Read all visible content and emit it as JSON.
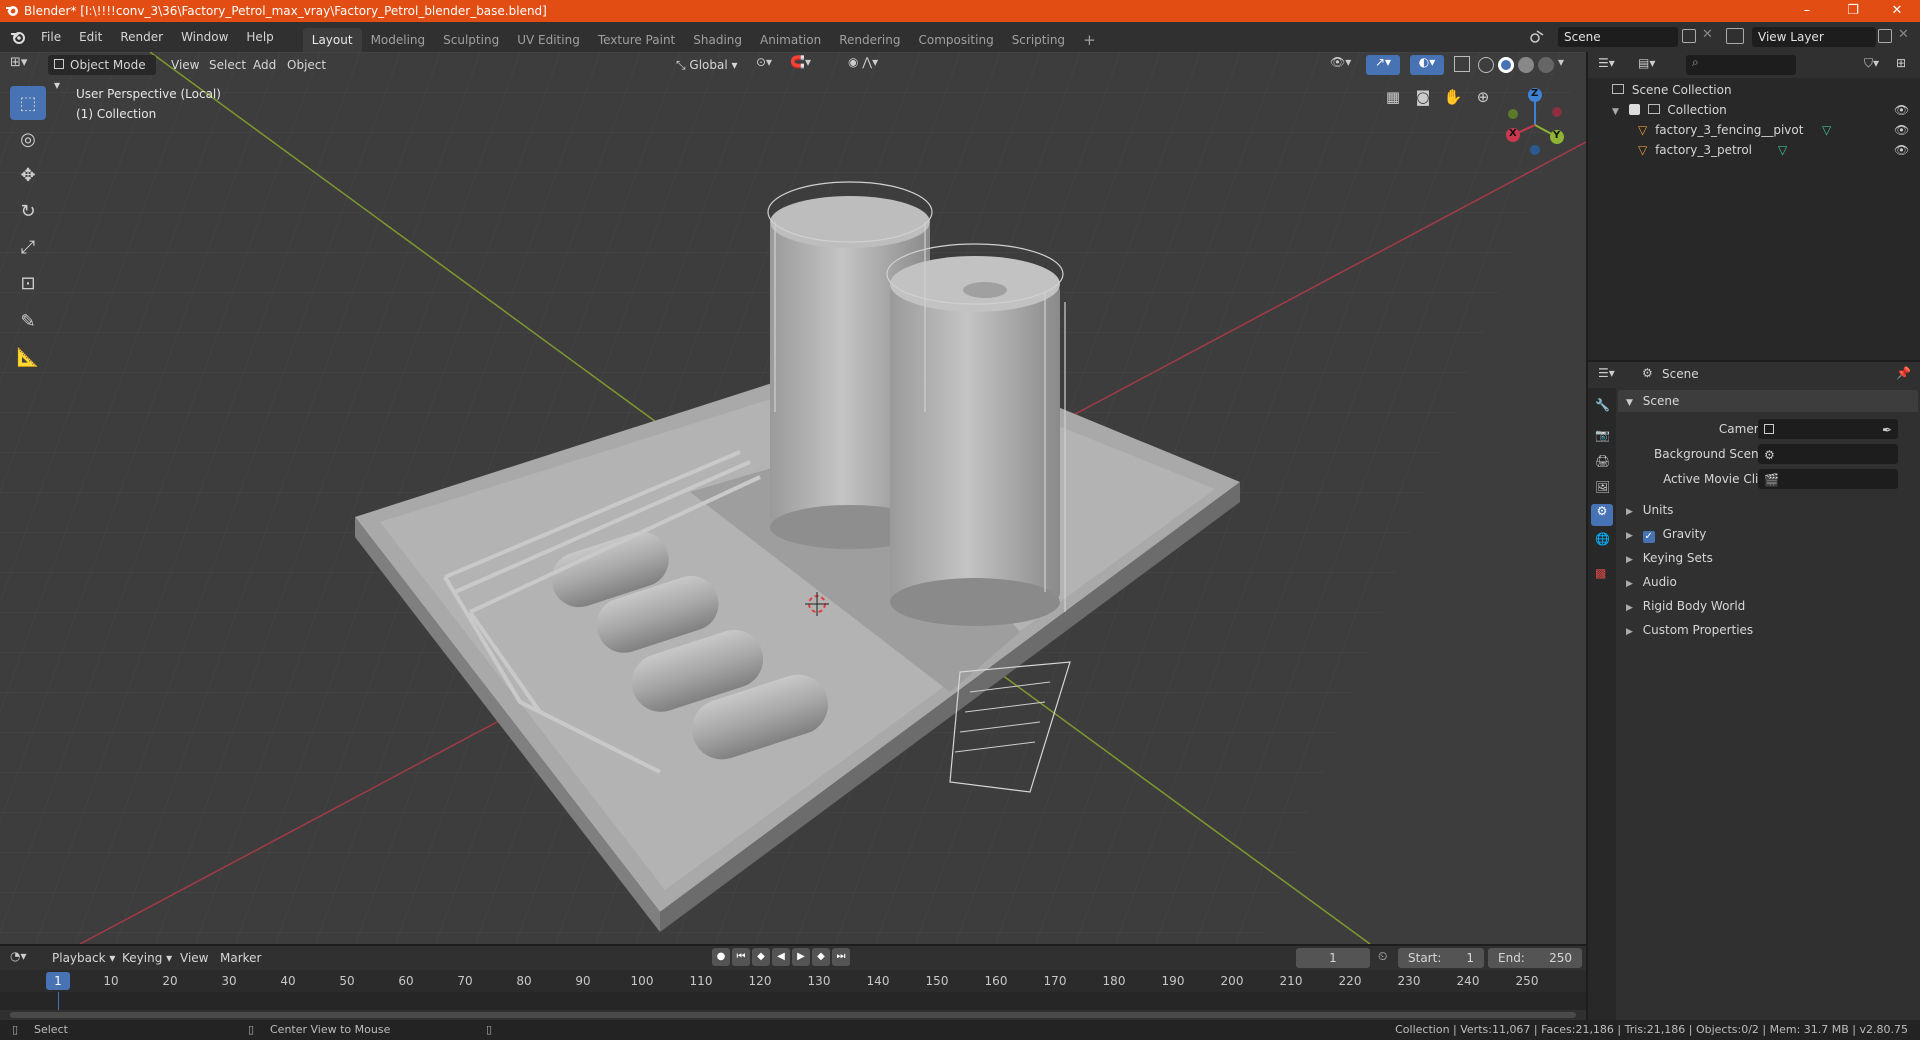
{
  "title": "Blender* [I:\\!!!!conv_3\\36\\Factory_Petrol_max_vray\\Factory_Petrol_blender_base.blend]",
  "window_controls": {
    "minimize": "–",
    "restore": "❐",
    "close": "✕"
  },
  "menus": [
    "File",
    "Edit",
    "Render",
    "Window",
    "Help"
  ],
  "workspaces": [
    "Layout",
    "Modeling",
    "Sculpting",
    "UV Editing",
    "Texture Paint",
    "Shading",
    "Animation",
    "Rendering",
    "Compositing",
    "Scripting"
  ],
  "active_workspace": "Layout",
  "add_workspace": "+",
  "scene_field": "Scene",
  "view_layer_field": "View Layer",
  "viewport": {
    "mode": "Object Mode",
    "menu": [
      "View",
      "Select",
      "Add",
      "Object"
    ],
    "orientation": "Global",
    "perspective_label": "User Perspective (Local)",
    "collection_label": "(1) Collection",
    "gizmo": {
      "x": "X",
      "y": "Y",
      "z": "Z"
    }
  },
  "outliner": {
    "root": "Scene Collection",
    "collection": "Collection",
    "objects": [
      "factory_3_fencing__pivot",
      "factory_3_petrol"
    ]
  },
  "properties": {
    "context": "Scene",
    "panel": "Scene",
    "camera_label": "Camera",
    "background_scene_label": "Background Scene",
    "active_movie_clip_label": "Active Movie Clip",
    "sections": [
      "Units",
      "Gravity",
      "Keying Sets",
      "Audio",
      "Rigid Body World",
      "Custom Properties"
    ],
    "gravity_checked": true
  },
  "timeline": {
    "menu": [
      "Playback",
      "Keying",
      "View",
      "Marker"
    ],
    "current_frame": "1",
    "start_label": "Start:",
    "start": "1",
    "end_label": "End:",
    "end": "250",
    "ruler": [
      "1",
      "10",
      "20",
      "30",
      "40",
      "50",
      "60",
      "70",
      "80",
      "90",
      "100",
      "110",
      "120",
      "130",
      "140",
      "150",
      "160",
      "170",
      "180",
      "190",
      "200",
      "210",
      "220",
      "230",
      "240",
      "250"
    ]
  },
  "status": {
    "left_action": "Select",
    "mid_action": "Center View to Mouse",
    "stats": "Collection | Verts:11,067 | Faces:21,186 | Tris:21,186 | Objects:0/2 | Mem: 31.7 MB | v2.80.75"
  },
  "colors": {
    "accent": "#4772b3",
    "titlebar": "#e24d13",
    "x_axis": "#c8394f",
    "y_axis": "#8fb332",
    "z_axis": "#3f82d1"
  }
}
